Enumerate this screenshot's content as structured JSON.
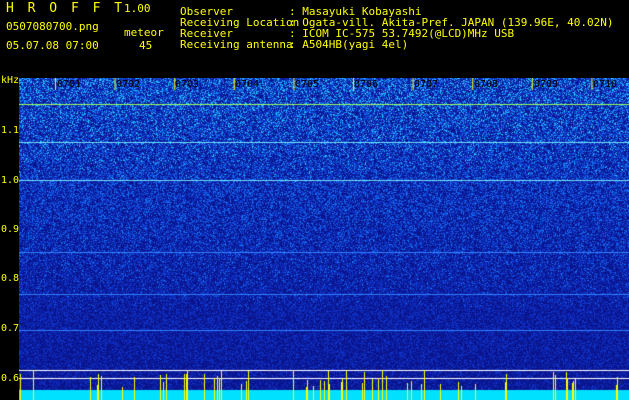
{
  "header": {
    "app_title": "H R O F F T",
    "version": "1.00",
    "filename": "0507080700.png",
    "datetime": "05.07.08 07:00",
    "count_label": "meteor",
    "count_value": "45"
  },
  "info": {
    "observer_label": "Observer",
    "observer_value": ": Masayuki Kobayashi",
    "location_label": "Receiving Location",
    "location_value": ": Ogata-vill. Akita-Pref. JAPAN (139.96E, 40.02N)",
    "receiver_label": "Receiver",
    "receiver_value": ": ICOM IC-575 53.7492(@LCD)MHz USB",
    "antenna_label": "Receiving antenna",
    "antenna_value": ": A504HB(yagi 4el)"
  },
  "axis": {
    "unit": "kHz",
    "ticks": [
      "1.1",
      "1.0",
      "0.9",
      "0.8",
      "0.7",
      "0.6"
    ]
  },
  "time_markers": [
    "0701",
    "0702",
    "0703",
    "0704",
    "0705",
    "0706",
    "0707",
    "0708",
    "0709",
    "0710"
  ],
  "colors": {
    "label": "#ffff00",
    "background": "#000000",
    "noise_base": "#1020a0",
    "noise_hi": "#30c0ff"
  }
}
